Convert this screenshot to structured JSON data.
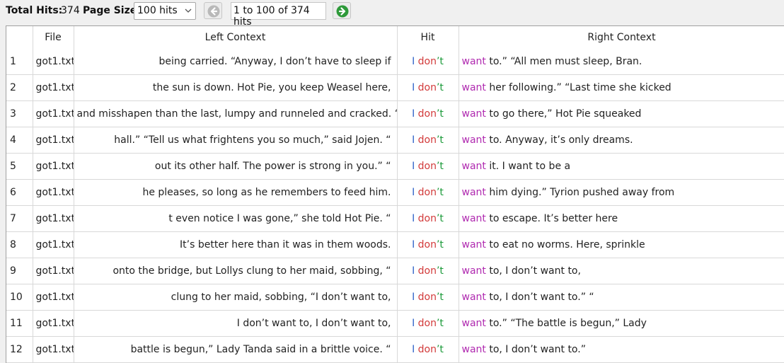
{
  "toolbar": {
    "total_hits_label": "Total Hits:",
    "total_hits_value": "374",
    "page_size_label": "Page Size",
    "page_size_selected": "100 hits",
    "prev_icon": "arrow-left-circle-icon",
    "next_icon": "arrow-right-circle-icon",
    "range_text": "1 to 100 of 374 hits"
  },
  "table": {
    "columns": [
      "",
      "File",
      "Left Context",
      "Hit",
      "Right Context"
    ],
    "rows": [
      {
        "num": "1",
        "file": "got1.txt",
        "left": "being carried. “Anyway, I don’t have to sleep if",
        "hit": [
          "I",
          "don",
          "’t"
        ],
        "right_word": "want",
        "right_rest": " to.” “All men must sleep, Bran."
      },
      {
        "num": "2",
        "file": "got1.txt",
        "left": "the sun is down. Hot Pie, you keep Weasel here,",
        "hit": [
          "I",
          "don",
          "’t"
        ],
        "right_word": "want",
        "right_rest": " her following.” “Last time she kicked"
      },
      {
        "num": "3",
        "file": "got1.txt",
        "left": "and misshapen than the last, lumpy and runneled and cracked. “",
        "hit": [
          "I",
          "don",
          "’t"
        ],
        "right_word": "want",
        "right_rest": " to go there,” Hot Pie squeaked"
      },
      {
        "num": "4",
        "file": "got1.txt",
        "left": "hall.” “Tell us what frightens you so much,” said Jojen. “",
        "hit": [
          "I",
          "don",
          "’t"
        ],
        "right_word": "want",
        "right_rest": " to. Anyway, it’s only dreams."
      },
      {
        "num": "5",
        "file": "got1.txt",
        "left": "out its other half. The power is strong in you.” “",
        "hit": [
          "I",
          "don",
          "’t"
        ],
        "right_word": "want",
        "right_rest": " it. I want to be a"
      },
      {
        "num": "6",
        "file": "got1.txt",
        "left": "he pleases, so long as he remembers to feed him.",
        "hit": [
          "I",
          "don",
          "’t"
        ],
        "right_word": "want",
        "right_rest": " him dying.” Tyrion pushed away from"
      },
      {
        "num": "7",
        "file": "got1.txt",
        "left": "t even notice I was gone,” she told Hot Pie. “",
        "hit": [
          "I",
          "don",
          "’t"
        ],
        "right_word": "want",
        "right_rest": " to escape. It’s better here"
      },
      {
        "num": "8",
        "file": "got1.txt",
        "left": "It’s better here than it was in them woods.",
        "hit": [
          "I",
          "don",
          "’t"
        ],
        "right_word": "want",
        "right_rest": " to eat no worms. Here, sprinkle"
      },
      {
        "num": "9",
        "file": "got1.txt",
        "left": "onto the bridge, but Lollys clung to her maid, sobbing, “",
        "hit": [
          "I",
          "don",
          "’t"
        ],
        "right_word": "want",
        "right_rest": " to, I don’t want to,"
      },
      {
        "num": "10",
        "file": "got1.txt",
        "left": "clung to her maid, sobbing, “I don’t want to,",
        "hit": [
          "I",
          "don",
          "’t"
        ],
        "right_word": "want",
        "right_rest": " to, I don’t want to.” “"
      },
      {
        "num": "11",
        "file": "got1.txt",
        "left": "I don’t want to, I don’t want to,",
        "hit": [
          "I",
          "don",
          "’t"
        ],
        "right_word": "want",
        "right_rest": " to.” “The battle is begun,” Lady"
      },
      {
        "num": "12",
        "file": "got1.txt",
        "left": "battle is begun,” Lady Tanda said in a brittle voice. “",
        "hit": [
          "I",
          "don",
          "’t"
        ],
        "right_word": "want",
        "right_rest": " to, I don’t want to.”"
      }
    ]
  }
}
